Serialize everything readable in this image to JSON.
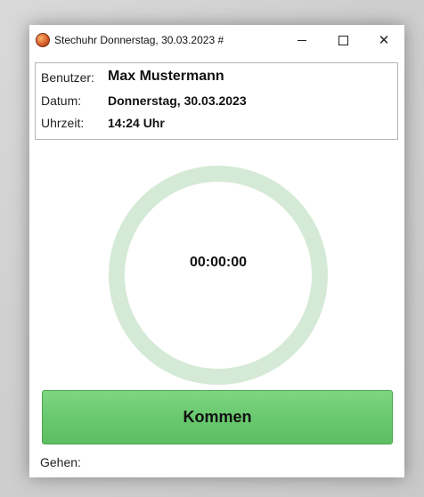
{
  "window": {
    "title": "Stechuhr Donnerstag, 30.03.2023 #",
    "controls": {
      "minimize": "minimize",
      "maximize": "maximize",
      "close": "✕"
    }
  },
  "info": {
    "user_label": "Benutzer:",
    "user_value": "Max Mustermann",
    "date_label": "Datum:",
    "date_value": "Donnerstag, 30.03.2023",
    "time_label": "Uhrzeit:",
    "time_value": "14:24 Uhr"
  },
  "timer": {
    "value": "00:00:00",
    "ring_color": "#d5ead6"
  },
  "actions": {
    "kommen_label": "Kommen",
    "kommen_color": "#6bca70",
    "gehen_label": "Gehen:"
  }
}
